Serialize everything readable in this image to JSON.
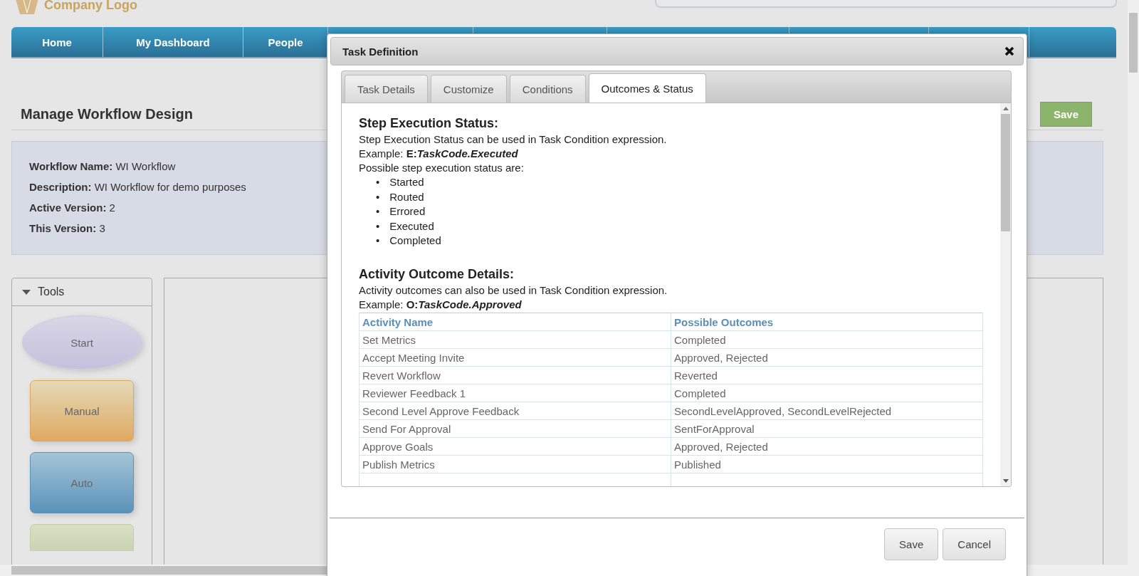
{
  "logo": {
    "text": "Company Logo"
  },
  "nav": [
    {
      "label": "Home"
    },
    {
      "label": "My Dashboard"
    },
    {
      "label": "People"
    }
  ],
  "page_title": "Manage Workflow Design",
  "save_button": "Save",
  "workflow_info": [
    {
      "label": "Workflow Name:",
      "value": "WI Workflow"
    },
    {
      "label": "Description:",
      "value": "WI Workflow for demo purposes"
    },
    {
      "label": "Active Version:",
      "value": "2"
    },
    {
      "label": "This Version:",
      "value": "3"
    }
  ],
  "tools": {
    "title": "Tools",
    "expanded": true,
    "items": [
      {
        "label": "Start",
        "kind": "start"
      },
      {
        "label": "Manual",
        "kind": "manual"
      },
      {
        "label": "Auto",
        "kind": "auto"
      },
      {
        "kind": "decision"
      }
    ]
  },
  "dialog": {
    "title": "Task Definition",
    "tabs": [
      {
        "label": "Task Details",
        "selected": false
      },
      {
        "label": "Customize",
        "selected": false
      },
      {
        "label": "Conditions",
        "selected": false
      },
      {
        "label": "Outcomes & Status",
        "selected": true
      }
    ],
    "step_status": {
      "heading": "Step Execution Status:",
      "description": "Step Execution Status can be used in Task Condition expression.",
      "example": {
        "label": "Example:",
        "prefix": "E:",
        "code": "TaskCode.Executed"
      },
      "list_intro": "Possible step execution status are:",
      "bullet": "•",
      "statuses": [
        "Started",
        "Routed",
        "Errored",
        "Executed",
        "Completed"
      ]
    },
    "outcomes": {
      "heading": "Activity Outcome Details:",
      "description": "Activity outcomes can also be used in Task Condition expression.",
      "example": {
        "label": "Example:",
        "prefix": "O:",
        "code": "TaskCode.Approved"
      },
      "columns": [
        "Activity Name",
        "Possible Outcomes"
      ],
      "rows": [
        [
          "Set Metrics",
          "Completed"
        ],
        [
          "Accept Meeting Invite",
          "Approved, Rejected"
        ],
        [
          "Revert Workflow",
          "Reverted"
        ],
        [
          "Reviewer Feedback 1",
          "Completed"
        ],
        [
          "Second Level Approve Feedback",
          "SecondLevelApproved, SecondLevelRejected"
        ],
        [
          "Send For Approval",
          "SentForApproval"
        ],
        [
          "Approve Goals",
          "Approved, Rejected"
        ],
        [
          "Publish Metrics",
          "Published"
        ]
      ]
    },
    "buttons": [
      "Save",
      "Cancel"
    ]
  }
}
